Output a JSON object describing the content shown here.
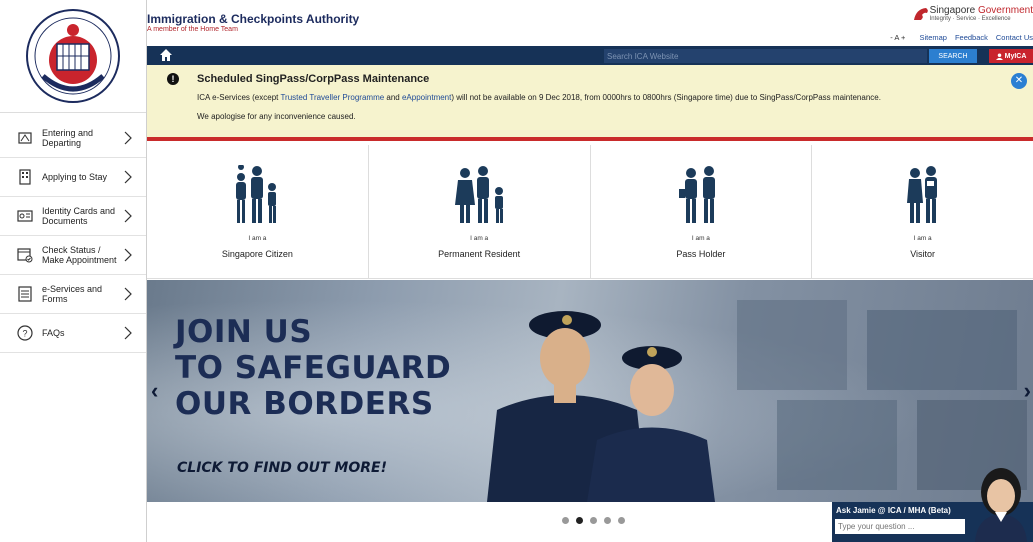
{
  "header": {
    "org_title": "Immigration & Checkpoints Authority",
    "org_subtitle": "A member of the Home Team",
    "gov_name_1": "Singapore ",
    "gov_name_2": "Government",
    "gov_tagline": "Integrity · Service · Excellence",
    "text_size": "- A +",
    "links": [
      "Sitemap",
      "Feedback",
      "Contact Us"
    ]
  },
  "navbar": {
    "search_placeholder": "Search ICA Website",
    "search_button": "SEARCH",
    "myica_button": "MyICA"
  },
  "sidebar": {
    "items": [
      {
        "label": "Entering and Departing",
        "icon": "passport-stamp-icon"
      },
      {
        "label": "Applying to Stay",
        "icon": "building-icon"
      },
      {
        "label": "Identity Cards and Documents",
        "icon": "id-card-icon"
      },
      {
        "label": "Check Status / Make Appointment",
        "icon": "calendar-check-icon"
      },
      {
        "label": "e-Services and Forms",
        "icon": "form-icon"
      },
      {
        "label": "FAQs",
        "icon": "question-icon"
      }
    ]
  },
  "alert": {
    "title": "Scheduled SingPass/CorpPass Maintenance",
    "body_pre": "ICA e-Services (except ",
    "link1": "Trusted Traveller Programme",
    "body_mid": " and ",
    "link2": "eAppointment",
    "body_post": ") will not be available on 9 Dec 2018, from 0000hrs to 0800hrs (Singapore time) due to SingPass/CorpPass maintenance.",
    "body2": "We apologise for any inconvenience caused."
  },
  "personas": [
    {
      "iam": "I am a",
      "label": "Singapore Citizen"
    },
    {
      "iam": "I am a",
      "label": "Permanent Resident"
    },
    {
      "iam": "I am a",
      "label": "Pass Holder"
    },
    {
      "iam": "I am a",
      "label": "Visitor"
    }
  ],
  "banner": {
    "line1": "JOIN US",
    "line2": "TO SAFEGUARD",
    "line3": "OUR BORDERS",
    "cta": "CLICK TO FIND OUT MORE!",
    "slide_count": 5,
    "active_slide": 2
  },
  "chat": {
    "title": "Ask Jamie @ ICA / MHA (Beta)",
    "placeholder": "Type your question ..."
  },
  "colors": {
    "navy": "#163257",
    "red": "#c92b2b",
    "alert_bg": "#f6f3ce",
    "link": "#1f4a97"
  }
}
